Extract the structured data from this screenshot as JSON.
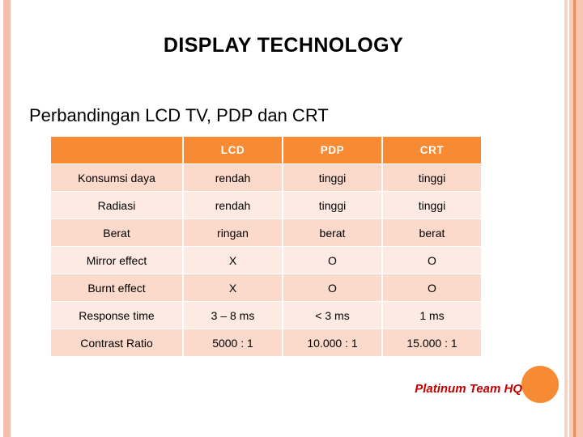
{
  "slide": {
    "title": "DISPLAY TECHNOLOGY",
    "subtitle": "Perbandingan LCD TV, PDP dan CRT",
    "footer": "Platinum Team  HQ",
    "accent_color": "#f68b33",
    "row_color_a": "#fbd9cb",
    "row_color_b": "#fdeae2",
    "stripe_color": "#f5bfab",
    "footer_color": "#c00000"
  },
  "table": {
    "columns": [
      "",
      "LCD",
      "PDP",
      "CRT"
    ],
    "rows": [
      {
        "label": "Konsumsi  daya",
        "lcd": "rendah",
        "pdp": "tinggi",
        "crt": "tinggi"
      },
      {
        "label": "Radiasi",
        "lcd": "rendah",
        "pdp": "tinggi",
        "crt": "tinggi"
      },
      {
        "label": "Berat",
        "lcd": "ringan",
        "pdp": "berat",
        "crt": "berat"
      },
      {
        "label": "Mirror effect",
        "lcd": "X",
        "pdp": "O",
        "crt": "O"
      },
      {
        "label": "Burnt effect",
        "lcd": "X",
        "pdp": "O",
        "crt": "O"
      },
      {
        "label": "Response time",
        "lcd": "3 – 8 ms",
        "pdp": "< 3 ms",
        "crt": "1 ms"
      },
      {
        "label": "Contrast Ratio",
        "lcd": "5000 : 1",
        "pdp": "10.000 : 1",
        "crt": "15.000 : 1"
      }
    ]
  }
}
